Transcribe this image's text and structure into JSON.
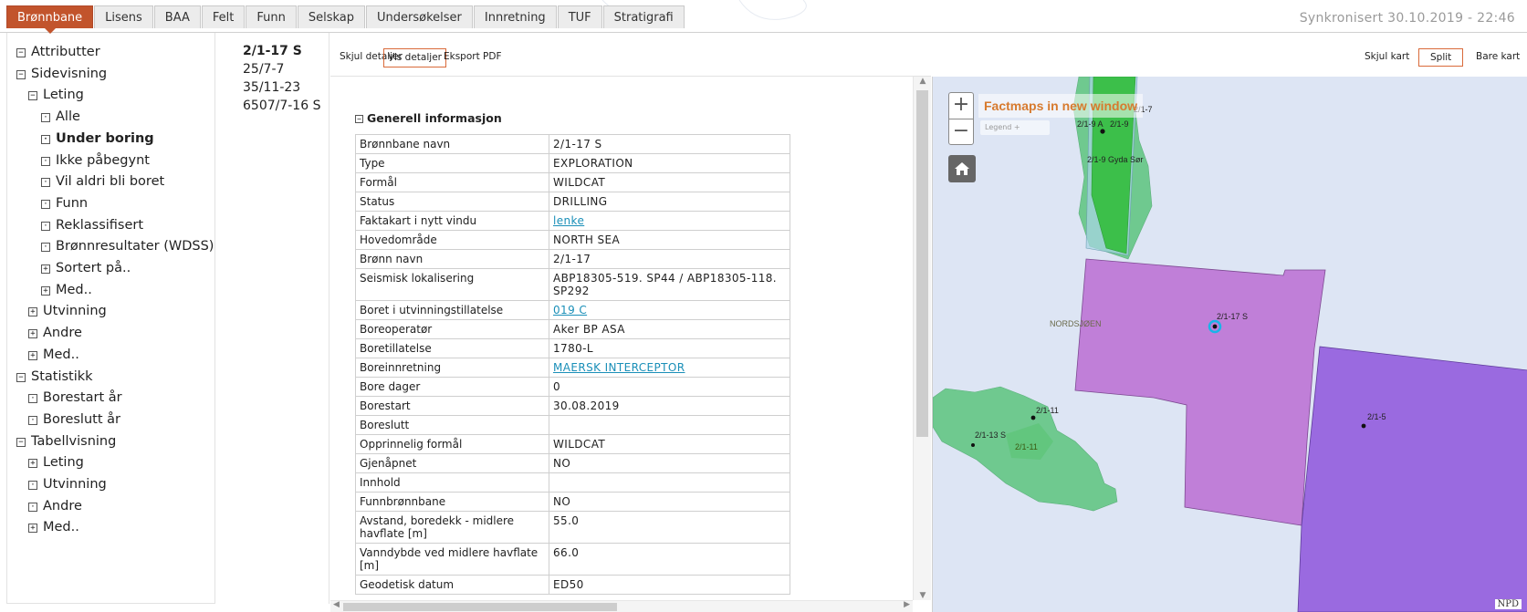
{
  "tabs": [
    "Brønnbane",
    "Lisens",
    "BAA",
    "Felt",
    "Funn",
    "Selskap",
    "Undersøkelser",
    "Innretning",
    "TUF",
    "Stratigrafi"
  ],
  "active_tab": "Brønnbane",
  "sync_text": "Synkronisert 30.10.2019 - 22:46",
  "tree": [
    {
      "label": "Attributter",
      "sign": "−",
      "level": 0
    },
    {
      "label": "Sidevisning",
      "sign": "−",
      "level": 0
    },
    {
      "label": "Leting",
      "sign": "−",
      "level": 1
    },
    {
      "label": "Alle",
      "sign": "·",
      "level": 2
    },
    {
      "label": "Under boring",
      "sign": "·",
      "level": 2,
      "bold": true
    },
    {
      "label": "Ikke påbegynt",
      "sign": "·",
      "level": 2
    },
    {
      "label": "Vil aldri bli boret",
      "sign": "·",
      "level": 2
    },
    {
      "label": "Funn",
      "sign": "·",
      "level": 2
    },
    {
      "label": "Reklassifisert",
      "sign": "·",
      "level": 2
    },
    {
      "label": "Brønnresultater (WDSS)",
      "sign": "·",
      "level": 2
    },
    {
      "label": "Sortert på..",
      "sign": "+",
      "level": 2
    },
    {
      "label": "Med..",
      "sign": "+",
      "level": 2
    },
    {
      "label": "Utvinning",
      "sign": "+",
      "level": 1
    },
    {
      "label": "Andre",
      "sign": "+",
      "level": 1
    },
    {
      "label": "Med..",
      "sign": "+",
      "level": 1
    },
    {
      "label": "Statistikk",
      "sign": "−",
      "level": 0
    },
    {
      "label": "Borestart år",
      "sign": "·",
      "level": 1
    },
    {
      "label": "Boreslutt år",
      "sign": "·",
      "level": 1
    },
    {
      "label": "Tabellvisning",
      "sign": "−",
      "level": 0
    },
    {
      "label": "Leting",
      "sign": "+",
      "level": 1
    },
    {
      "label": "Utvinning",
      "sign": "·",
      "level": 1
    },
    {
      "label": "Andre",
      "sign": "·",
      "level": 1
    },
    {
      "label": "Med..",
      "sign": "+",
      "level": 1
    }
  ],
  "wells": [
    "2/1-17 S",
    "25/7-7",
    "35/11-23",
    "6507/7-16 S"
  ],
  "selected_well": "2/1-17 S",
  "details_toolbar": {
    "hide": "Skjul detaljer",
    "show": "Vis detaljer",
    "export": "Eksport PDF"
  },
  "section": {
    "sign": "−",
    "title": "Generell informasjon"
  },
  "info_rows": [
    {
      "key": "Brønnbane navn",
      "value": "2/1-17 S"
    },
    {
      "key": "Type",
      "value": "EXPLORATION"
    },
    {
      "key": "Formål",
      "value": "WILDCAT"
    },
    {
      "key": "Status",
      "value": "DRILLING"
    },
    {
      "key": "Faktakart i nytt vindu",
      "value": "lenke",
      "link": true
    },
    {
      "key": "Hovedområde",
      "value": "NORTH SEA"
    },
    {
      "key": "Brønn navn",
      "value": "2/1-17"
    },
    {
      "key": "Seismisk lokalisering",
      "value": "ABP18305-519. SP44 / ABP18305-118. SP292"
    },
    {
      "key": "Boret i utvinningstillatelse",
      "value": "019 C",
      "link": true
    },
    {
      "key": "Boreoperatør",
      "value": "Aker BP ASA"
    },
    {
      "key": "Boretillatelse",
      "value": "1780-L"
    },
    {
      "key": "Boreinnretning",
      "value": "MAERSK INTERCEPTOR",
      "link": true
    },
    {
      "key": "Bore dager",
      "value": "0"
    },
    {
      "key": "Borestart",
      "value": "30.08.2019"
    },
    {
      "key": "Boreslutt",
      "value": ""
    },
    {
      "key": "Opprinnelig formål",
      "value": "WILDCAT"
    },
    {
      "key": "Gjenåpnet",
      "value": "NO"
    },
    {
      "key": "Innhold",
      "value": ""
    },
    {
      "key": "Funnbrønnbane",
      "value": "NO"
    },
    {
      "key": "Avstand, boredekk - midlere havflate [m]",
      "value": "55.0"
    },
    {
      "key": "Vanndybde ved midlere havflate [m]",
      "value": "66.0"
    },
    {
      "key": "Geodetisk datum",
      "value": "ED50"
    }
  ],
  "map_toolbar": {
    "hide": "Skjul kart",
    "split": "Split",
    "only": "Bare kart"
  },
  "map": {
    "factmaps_link": "Factmaps in new window",
    "legend": "Legend +",
    "zoom_in": "+",
    "zoom_out": "−",
    "attribution": "NPD",
    "labels": {
      "w217": "2/1-7",
      "w219a": "2/1-9 A",
      "w219": "2/1-9",
      "gyda": "2/1-9 Gyda Sør",
      "w2117s": "2/1-17 S",
      "nordsjoen": "NORDSJØEN",
      "w2111": "2/1-11",
      "w2111b": "2/1-11",
      "w2113s": "2/1-13 S",
      "w215": "2/1-5"
    },
    "colors": {
      "sea": "#dde5f4",
      "green": "#6fc98f",
      "brightgreen": "#3cbf4a",
      "purple": "#c07fd8",
      "violet": "#9a6ae0"
    }
  }
}
